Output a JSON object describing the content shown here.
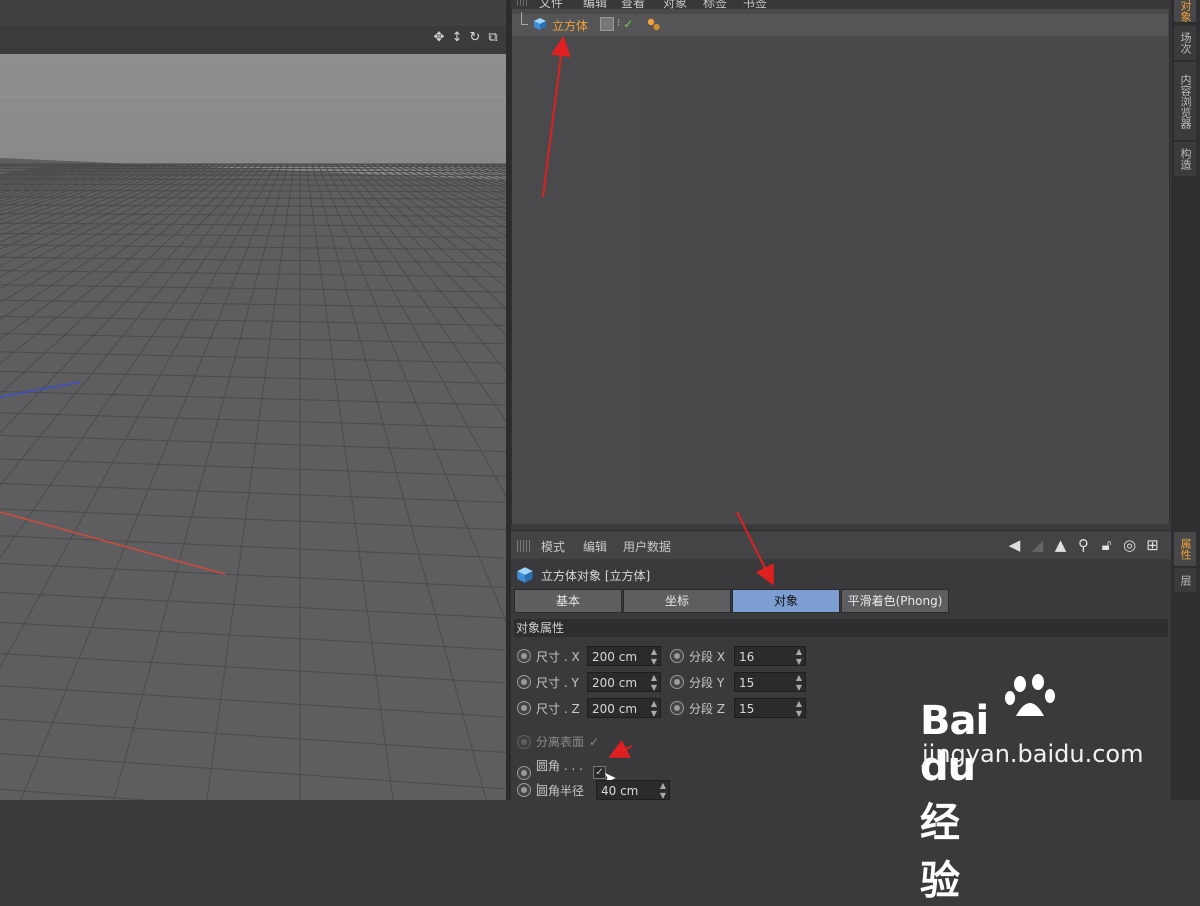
{
  "object_manager": {
    "menu": [
      "文件",
      "编辑",
      "查看",
      "对象",
      "标签",
      "书签"
    ],
    "object": {
      "name": "立方体",
      "icon": "cube-icon"
    }
  },
  "side_tabs": {
    "upper": [
      "对象",
      "场次",
      "内容浏览器",
      "构造"
    ],
    "lower": [
      "属性",
      "层"
    ]
  },
  "attribute_manager": {
    "menu": [
      "模式",
      "编辑",
      "用户数据"
    ],
    "nav_icons": [
      "arrow-left-icon",
      "arrow-up-icon",
      "search-icon",
      "lock-icon",
      "target-icon",
      "add-icon"
    ],
    "title": "立方体对象 [立方体]",
    "tabs": [
      "基本",
      "坐标",
      "对象",
      "平滑着色(Phong)"
    ],
    "active_tab": "对象",
    "section": "对象属性",
    "size": [
      {
        "label": "尺寸 . X",
        "value": "200 cm",
        "seg_label": "分段 X",
        "seg_value": "16"
      },
      {
        "label": "尺寸 . Y",
        "value": "200 cm",
        "seg_label": "分段 Y",
        "seg_value": "15"
      },
      {
        "label": "尺寸 . Z",
        "value": "200 cm",
        "seg_label": "分段 Z",
        "seg_value": "15"
      }
    ],
    "separate_surfaces": {
      "label": "分离表面",
      "checked": true,
      "enabled": false
    },
    "fillet": {
      "label": "圆角 . . . .",
      "checked": true
    },
    "fillet_radius": {
      "label": "圆角半径",
      "value": "40 cm"
    }
  },
  "watermark": {
    "brand": "Bai du 经验",
    "url": "jingyan.baidu.com"
  },
  "colors": {
    "accent": "#f0a23a",
    "active_tab": "#7d9ed0",
    "annotation": "#e02020"
  }
}
